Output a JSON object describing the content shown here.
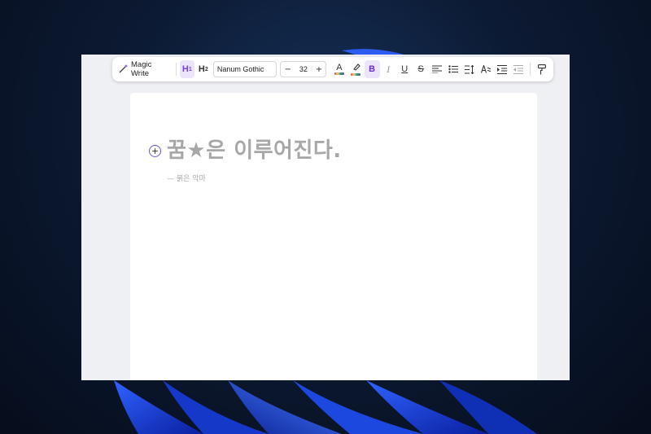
{
  "wallpaper": {
    "accent": "#1e47d9",
    "background": "#0c1a33"
  },
  "toolbar": {
    "magic_write_label": "Magic Write",
    "h1_label": "H",
    "h1_sub": "1",
    "h2_label": "H",
    "h2_sub": "2",
    "font_family": "Nanum Gothic",
    "decrease_label": "−",
    "font_size": "32",
    "increase_label": "+",
    "text_color_label": "A",
    "bold_label": "B",
    "italic_label": "I",
    "underline_label": "U",
    "strike_label": "S",
    "active_color": "#7b3fe4"
  },
  "document": {
    "add_label": "+",
    "heading": "꿈★은 이루어진다.",
    "attribution": "— 붉은 악마"
  }
}
